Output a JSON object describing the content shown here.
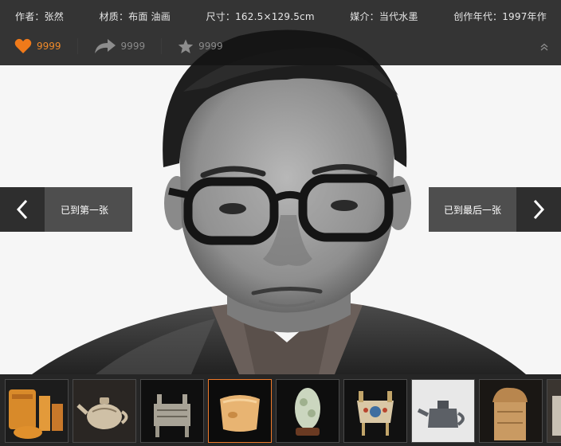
{
  "info": {
    "author": "作者：张然",
    "material": "材质：布面 油画",
    "size": "尺寸：162.5×129.5cm",
    "medium": "媒介：当代水墨",
    "year": "创作年代：1997年作"
  },
  "actions": {
    "like_count": "9999",
    "share_count": "9999",
    "favorite_count": "9999"
  },
  "nav": {
    "prev_label": "已到第一张",
    "next_label": "已到最后一张"
  },
  "thumbnails": [
    {
      "name": "thumb-seal-stones",
      "active": false
    },
    {
      "name": "thumb-teapot",
      "active": false
    },
    {
      "name": "thumb-bronze-ding",
      "active": false
    },
    {
      "name": "thumb-yellow-seal",
      "active": true
    },
    {
      "name": "thumb-jade-carving",
      "active": false
    },
    {
      "name": "thumb-cloisonne-censer",
      "active": false
    },
    {
      "name": "thumb-dark-teapot",
      "active": false
    },
    {
      "name": "thumb-carved-seal",
      "active": false
    },
    {
      "name": "thumb-partial",
      "active": false
    }
  ],
  "colors": {
    "accent": "#f08a2a",
    "active_border": "#f07a2a",
    "bar_bg": "#141414"
  }
}
